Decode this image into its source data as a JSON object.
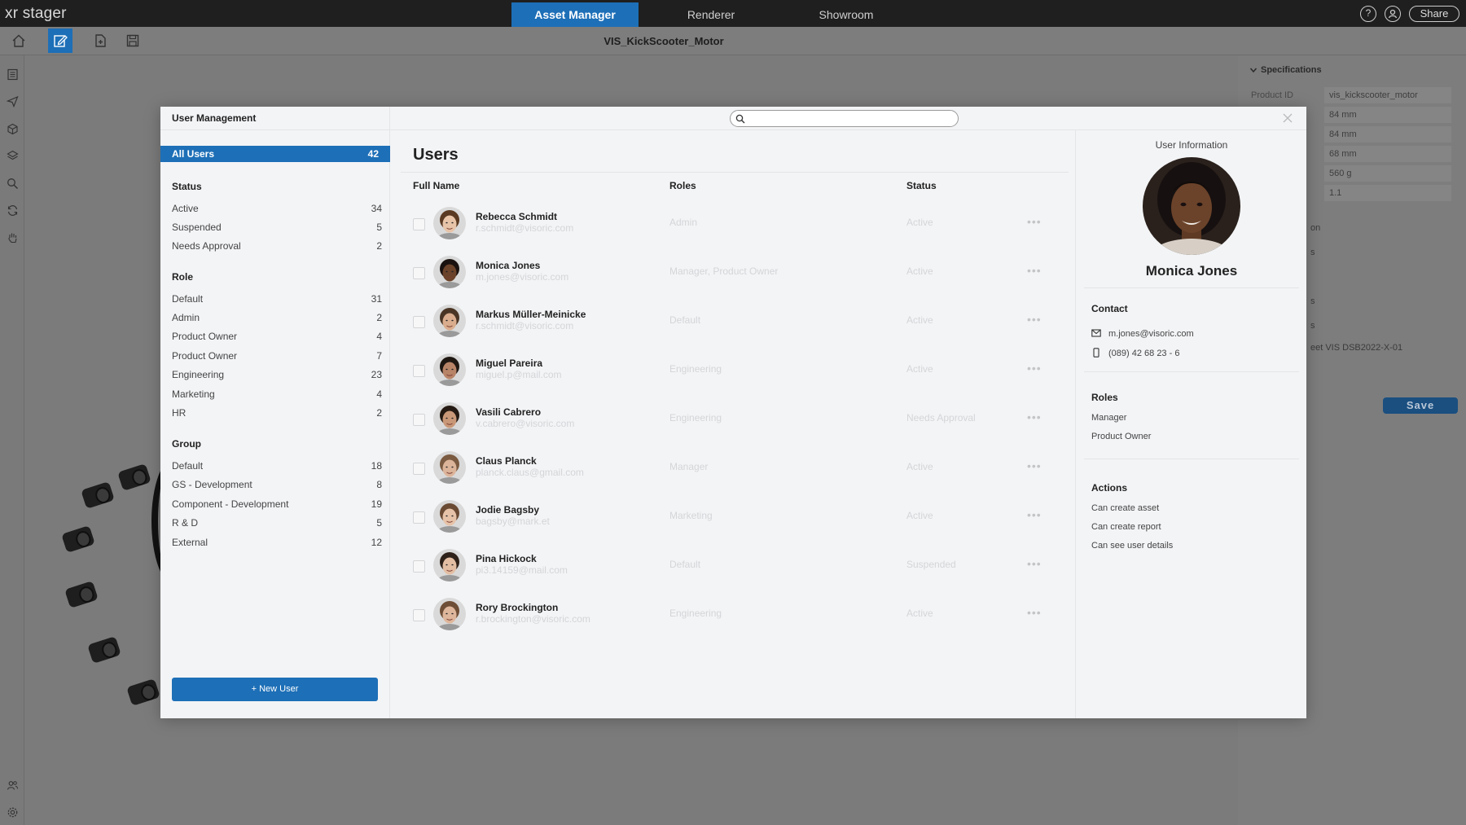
{
  "app": {
    "logo": "xr stager",
    "tabs": [
      {
        "label": "Asset Manager",
        "active": true
      },
      {
        "label": "Renderer",
        "active": false
      },
      {
        "label": "Showroom",
        "active": false
      }
    ],
    "share_label": "Share",
    "help_glyph": "?"
  },
  "toolbar": {
    "document_title": "VIS_KickScooter_Motor",
    "icons": [
      "home-icon",
      "edit-icon",
      "add-file-icon",
      "save-icon"
    ]
  },
  "specs_panel": {
    "title": "Specifications",
    "product_id_label": "Product ID",
    "values": [
      "vis_kickscooter_motor",
      "84 mm",
      "84 mm",
      "68 mm",
      "560 g",
      "1.1"
    ],
    "fragments": [
      "on",
      "s",
      "s",
      "s",
      "eet VIS DSB2022-X-01"
    ],
    "save_label": "Save"
  },
  "modal": {
    "title": "User Management",
    "search": {
      "placeholder": "",
      "value": ""
    },
    "all_users": {
      "label": "All Users",
      "count": "42"
    },
    "filters": {
      "status": {
        "heading": "Status",
        "items": [
          {
            "label": "Active",
            "count": "34"
          },
          {
            "label": "Suspended",
            "count": "5"
          },
          {
            "label": "Needs Approval",
            "count": "2"
          }
        ]
      },
      "role": {
        "heading": "Role",
        "items": [
          {
            "label": "Default",
            "count": "31"
          },
          {
            "label": "Admin",
            "count": "2"
          },
          {
            "label": "Product Owner",
            "count": "4"
          },
          {
            "label": "Product Owner",
            "count": "7"
          },
          {
            "label": "Engineering",
            "count": "23"
          },
          {
            "label": "Marketing",
            "count": "4"
          },
          {
            "label": "HR",
            "count": "2"
          }
        ]
      },
      "group": {
        "heading": "Group",
        "items": [
          {
            "label": "Default",
            "count": "18"
          },
          {
            "label": "GS - Development",
            "count": "8"
          },
          {
            "label": "Component - Development",
            "count": "19"
          },
          {
            "label": "R & D",
            "count": "5"
          },
          {
            "label": "External",
            "count": "12"
          }
        ]
      }
    },
    "new_user_label": "+ New User",
    "users_title": "Users",
    "columns": {
      "name": "Full Name",
      "roles": "Roles",
      "status": "Status"
    },
    "users": [
      {
        "name": "Rebecca Schmidt",
        "email": "r.schmidt@visoric.com",
        "roles": "Admin",
        "status": "Active",
        "skin": "#e8c4a8",
        "hair": "#5a3a22"
      },
      {
        "name": "Monica Jones",
        "email": "m.jones@visoric.com",
        "roles": "Manager, Product Owner",
        "status": "Active",
        "skin": "#6b432a",
        "hair": "#1a1210"
      },
      {
        "name": "Markus Müller-Meinicke",
        "email": "r.schmidt@visoric.com",
        "roles": "Default",
        "status": "Active",
        "skin": "#d9ad8e",
        "hair": "#4a3525"
      },
      {
        "name": "Miguel Pareira",
        "email": "miguel.p@mail.com",
        "roles": "Engineering",
        "status": "Active",
        "skin": "#b88468",
        "hair": "#1f1712"
      },
      {
        "name": "Vasili Cabrero",
        "email": "v.cabrero@visoric.com",
        "roles": "Engineering",
        "status": "Needs Approval",
        "skin": "#c99878",
        "hair": "#251a13"
      },
      {
        "name": "Claus Planck",
        "email": "planck.claus@gmail.com",
        "roles": "Manager",
        "status": "Active",
        "skin": "#dcb49a",
        "hair": "#7a5a40"
      },
      {
        "name": "Jodie Bagsby",
        "email": "bagsby@mark.et",
        "roles": "Marketing",
        "status": "Active",
        "skin": "#e6c2a8",
        "hair": "#6a4a33"
      },
      {
        "name": "Pina Hickock",
        "email": "pi3.14159@mail.com",
        "roles": "Default",
        "status": "Suspended",
        "skin": "#e3bea3",
        "hair": "#2e2119"
      },
      {
        "name": "Rory Brockington",
        "email": "r.brockington@visoric.com",
        "roles": "Engineering",
        "status": "Active",
        "skin": "#deb69b",
        "hair": "#6e4e36"
      }
    ],
    "user_info": {
      "title": "User Information",
      "name": "Monica Jones",
      "contact_heading": "Contact",
      "email": "m.jones@visoric.com",
      "phone": "(089) 42 68 23 - 6",
      "roles_heading": "Roles",
      "roles": [
        "Manager",
        "Product Owner"
      ],
      "actions_heading": "Actions",
      "actions": [
        "Can create asset",
        "Can create report",
        "Can see user details"
      ]
    }
  },
  "colors": {
    "accent": "#1d6fb7",
    "topbar": "#1f1f1f",
    "modal_bg": "#f3f4f6"
  }
}
